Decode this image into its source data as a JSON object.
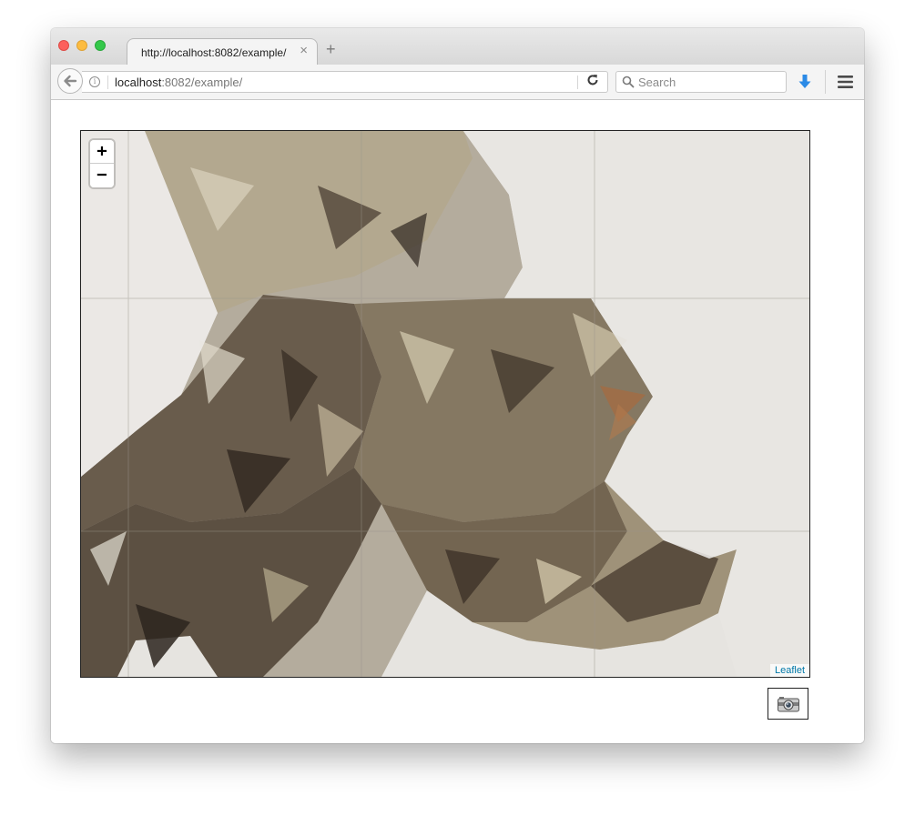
{
  "browser": {
    "tab": {
      "title": "http://localhost:8082/example/",
      "close_glyph": "×"
    },
    "new_tab_glyph": "+",
    "address_bar": {
      "host": "localhost",
      "rest": ":8082/example/"
    },
    "search": {
      "placeholder": "Search"
    },
    "icons": [
      "back-icon",
      "info-icon",
      "reload-icon",
      "search-icon",
      "download-icon",
      "menu-icon"
    ],
    "accent_color": "#2b8ae6"
  },
  "map": {
    "zoom_in_label": "+",
    "zoom_out_label": "−",
    "attribution": "Leaflet",
    "palette": [
      "#3a3026",
      "#5e5142",
      "#8a7d66",
      "#b0a58c",
      "#d2cab2",
      "#e8e6e2"
    ]
  },
  "export": {
    "icon": "camera-icon"
  }
}
